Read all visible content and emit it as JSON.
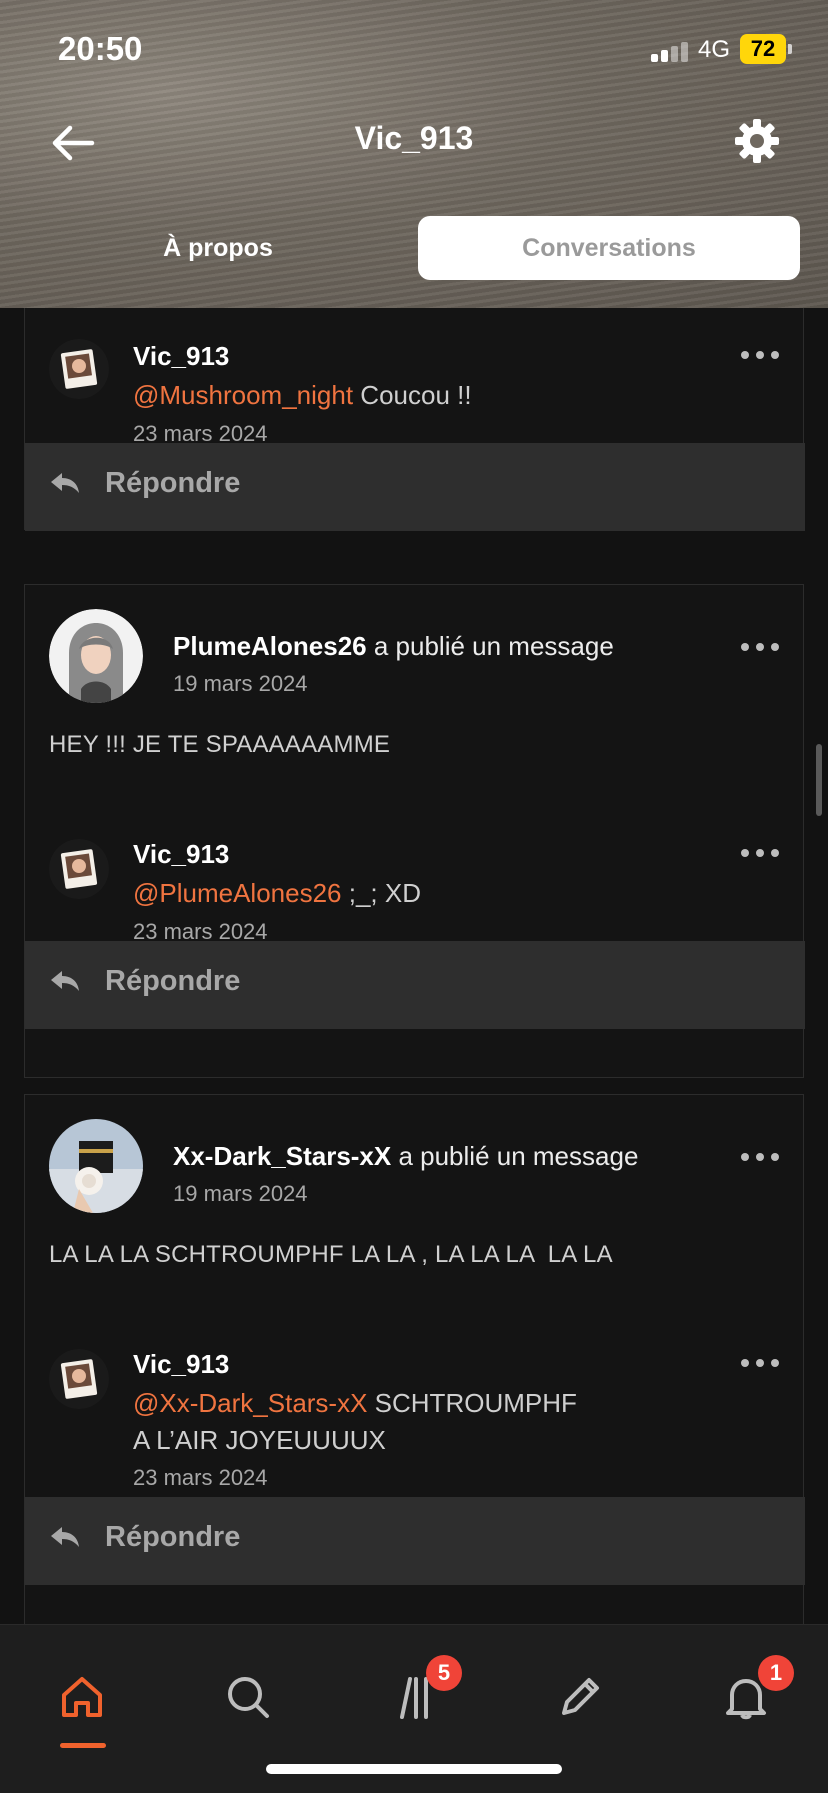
{
  "status_bar": {
    "time": "20:50",
    "network": "4G",
    "battery": "72"
  },
  "header": {
    "title": "Vic_913"
  },
  "tabs": [
    {
      "label": "À propos",
      "active": false
    },
    {
      "label": "Conversations",
      "active": true
    }
  ],
  "threads": [
    {
      "replies": [
        {
          "author": "Vic_913",
          "mention": "@Mushroom_night",
          "text": " Coucou !!",
          "date": "23 mars 2024"
        }
      ],
      "reply_label": "Répondre"
    },
    {
      "post": {
        "author": "PlumeAlones26",
        "action": " a publié un message",
        "date": "19 mars 2024",
        "body": "HEY !!! JE TE SPAAAAAAMME"
      },
      "replies": [
        {
          "author": "Vic_913",
          "mention": "@PlumeAlones26",
          "text": " ;_; XD",
          "date": "23 mars 2024"
        }
      ],
      "reply_label": "Répondre"
    },
    {
      "post": {
        "author": "Xx-Dark_Stars-xX",
        "action": " a publié un message",
        "date": "19 mars 2024",
        "body": "LA LA LA SCHTROUMPHF LA LA , LA LA LA  LA LA"
      },
      "replies": [
        {
          "author": "Vic_913",
          "mention": "@Xx-Dark_Stars-xX",
          "text": " SCHTROUMPHF A L’AIR JOYEUUUUX",
          "date": "23 mars 2024"
        }
      ],
      "reply_label": "Répondre"
    }
  ],
  "bottom_nav": {
    "items": [
      "home-icon",
      "search-icon",
      "library-icon",
      "pencil-icon",
      "bell-icon"
    ],
    "library_badge": "5",
    "notifications_badge": "1",
    "accent": "#f0622d"
  },
  "colors": {
    "mention": "#f07440",
    "background": "#121212"
  }
}
